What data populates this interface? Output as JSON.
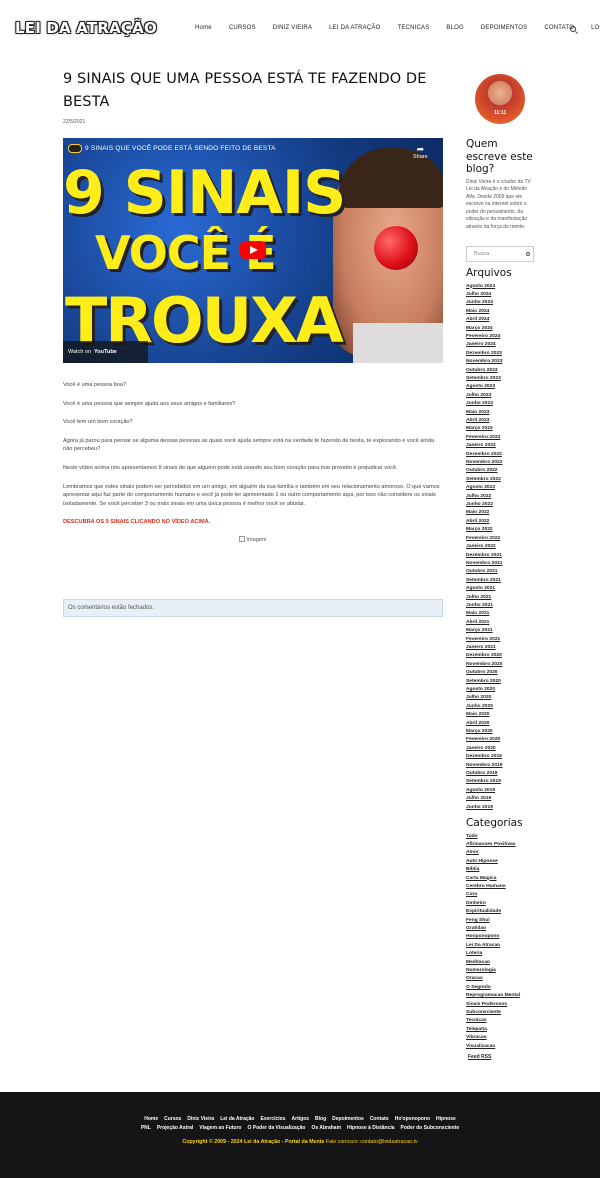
{
  "site": {
    "logo": "LEI DA ATRAÇÃO",
    "nav": [
      "Home",
      "CURSOS",
      "DINIZ VIEIRA",
      "LEI DA ATRAÇÃO",
      "TECNICAS",
      "BLOG",
      "DEPOIMENTOS",
      "CONTATO",
      "LOGIN"
    ]
  },
  "post": {
    "title": "9 SINAIS QUE UMA PESSOA ESTÁ TE FAZENDO DE BESTA",
    "date": "22/5/2021",
    "video": {
      "title": "9 SINAIS QUE VOCÊ PODE ESTÁ SENDO FEITO DE BESTA",
      "share_label": "Share",
      "thumb_line1": "9 SINAIS",
      "thumb_line2": "VOCÊ É",
      "thumb_line3": "TROUXA",
      "watch_on": "Watch on",
      "youtube": "YouTube"
    },
    "paragraphs": [
      "Você é uma pessoa boa?",
      "Você é uma pessoa que sempre ajuda aos seus amigos e familiares?",
      "Você tem um bom coração?",
      "Agora já parou para pensar se alguma dessas pessoas as quais você ajuda sempre está na verdade te fazendo de besta, te explorando e você ainda não percebeu?",
      "Neste vídeo acima nós apresentamos 9 sinais de que alguém pode está usando seu bom coração para tirar proveito e prejudicar você.",
      "Lembramos que estes sinais podem ser percebidos em um amigo, em alguém da sua família e também em seu relacionamento amoroso. O que vamos apresentar aqui faz parte do comportamento humano e você já pode ter apresentado 1 ou outro comportamento aqui, por isso não considere os sinais isoladamente. Se você perceber 3 ou mais sinais em uma única pessoa é melhor você se afastar."
    ],
    "cta": "DESCUBRA OS 9 SINAIS CLICANDO NO VÍDEO ACIMA.",
    "image_alt": "Imagem",
    "comments_closed": "Os comentários estão fechados."
  },
  "sidebar": {
    "about_title": "Quem escreve este blog?",
    "about_text": "Diniz Vieira é o criador da TV Lei da Atração e do Método Alfa. Desde 2009 que ele escreve na internet sobre o poder do pensamento, da vibração e da manifestação através da força da mente.",
    "avatar_text": "11:11",
    "search_placeholder": "Busca",
    "archives_title": "Arquivos",
    "archives": [
      "Agosto 2024",
      "Julho 2024",
      "Junho 2024",
      "Maio 2024",
      "Abril 2024",
      "Março 2024",
      "Fevereiro 2024",
      "Janeiro 2024",
      "Dezembro 2023",
      "Novembro 2023",
      "Outubro 2023",
      "Setembro 2023",
      "Agosto 2023",
      "Julho 2023",
      "Junho 2023",
      "Maio 2023",
      "Abril 2023",
      "Março 2023",
      "Fevereiro 2023",
      "Janeiro 2023",
      "Dezembro 2022",
      "Novembro 2022",
      "Outubro 2022",
      "Setembro 2022",
      "Agosto 2022",
      "Julho 2022",
      "Junho 2022",
      "Maio 2022",
      "Abril 2022",
      "Março 2022",
      "Fevereiro 2022",
      "Janeiro 2022",
      "Dezembro 2021",
      "Novembro 2021",
      "Outubro 2021",
      "Setembro 2021",
      "Agosto 2021",
      "Julho 2021",
      "Junho 2021",
      "Maio 2021",
      "Abril 2021",
      "Março 2021",
      "Fevereiro 2021",
      "Janeiro 2021",
      "Dezembro 2020",
      "Novembro 2020",
      "Outubro 2020",
      "Setembro 2020",
      "Agosto 2020",
      "Julho 2020",
      "Junho 2020",
      "Maio 2020",
      "Abril 2020",
      "Março 2020",
      "Fevereiro 2020",
      "Janeiro 2020",
      "Dezembro 2019",
      "Novembro 2019",
      "Outubro 2019",
      "Setembro 2019",
      "Agosto 2019",
      "Julho 2019",
      "Junho 2019"
    ],
    "categories_title": "Categorias",
    "categories": [
      "Tudo",
      "Afirmacoes Positivas",
      "Amor",
      "Auto Hipnose",
      "Biblia",
      "Carta Magica",
      "Cerebro Humano",
      "Cura",
      "Dinheiro",
      "Espiritualidade",
      "Feng Shui",
      "Gratidao",
      "Hooponopono",
      "Lei Da Atracao",
      "Loteria",
      "Meditacao",
      "Numerologia",
      "Oracao",
      "O Segredo",
      "Reprogramacao Mental",
      "Sinais Poderosos",
      "Subconsciente",
      "Tecnicas",
      "Telepatia",
      "Vibracao",
      "Visualizacao"
    ],
    "rss": "Feed RSS"
  },
  "footer": {
    "links_row1": [
      "Home",
      "Cursos",
      "Diniz Vieira",
      "Lei da Atração",
      "Exercícios",
      "Artigos",
      "Blog",
      "Depoimentos",
      "Contato",
      "Ho'oponopono",
      "Hipnose"
    ],
    "links_row2": [
      "PNL",
      "Projeção Astral",
      "Viagem ao Futuro",
      "O Poder da Visualização",
      "Os Abraham",
      "Hipnose à Distância",
      "Poder do Subconsciente"
    ],
    "copyright": "Copyright © 2009 - 2024 Lei da Atração - Portal da Mente",
    "contact": "Fale conosco: contato@leidaatracao.tv"
  },
  "colors": {
    "accent": "#e02a14",
    "footer_bg": "#151517",
    "footer_copy": "#ffd500",
    "comments_bg": "#e8eff7"
  }
}
